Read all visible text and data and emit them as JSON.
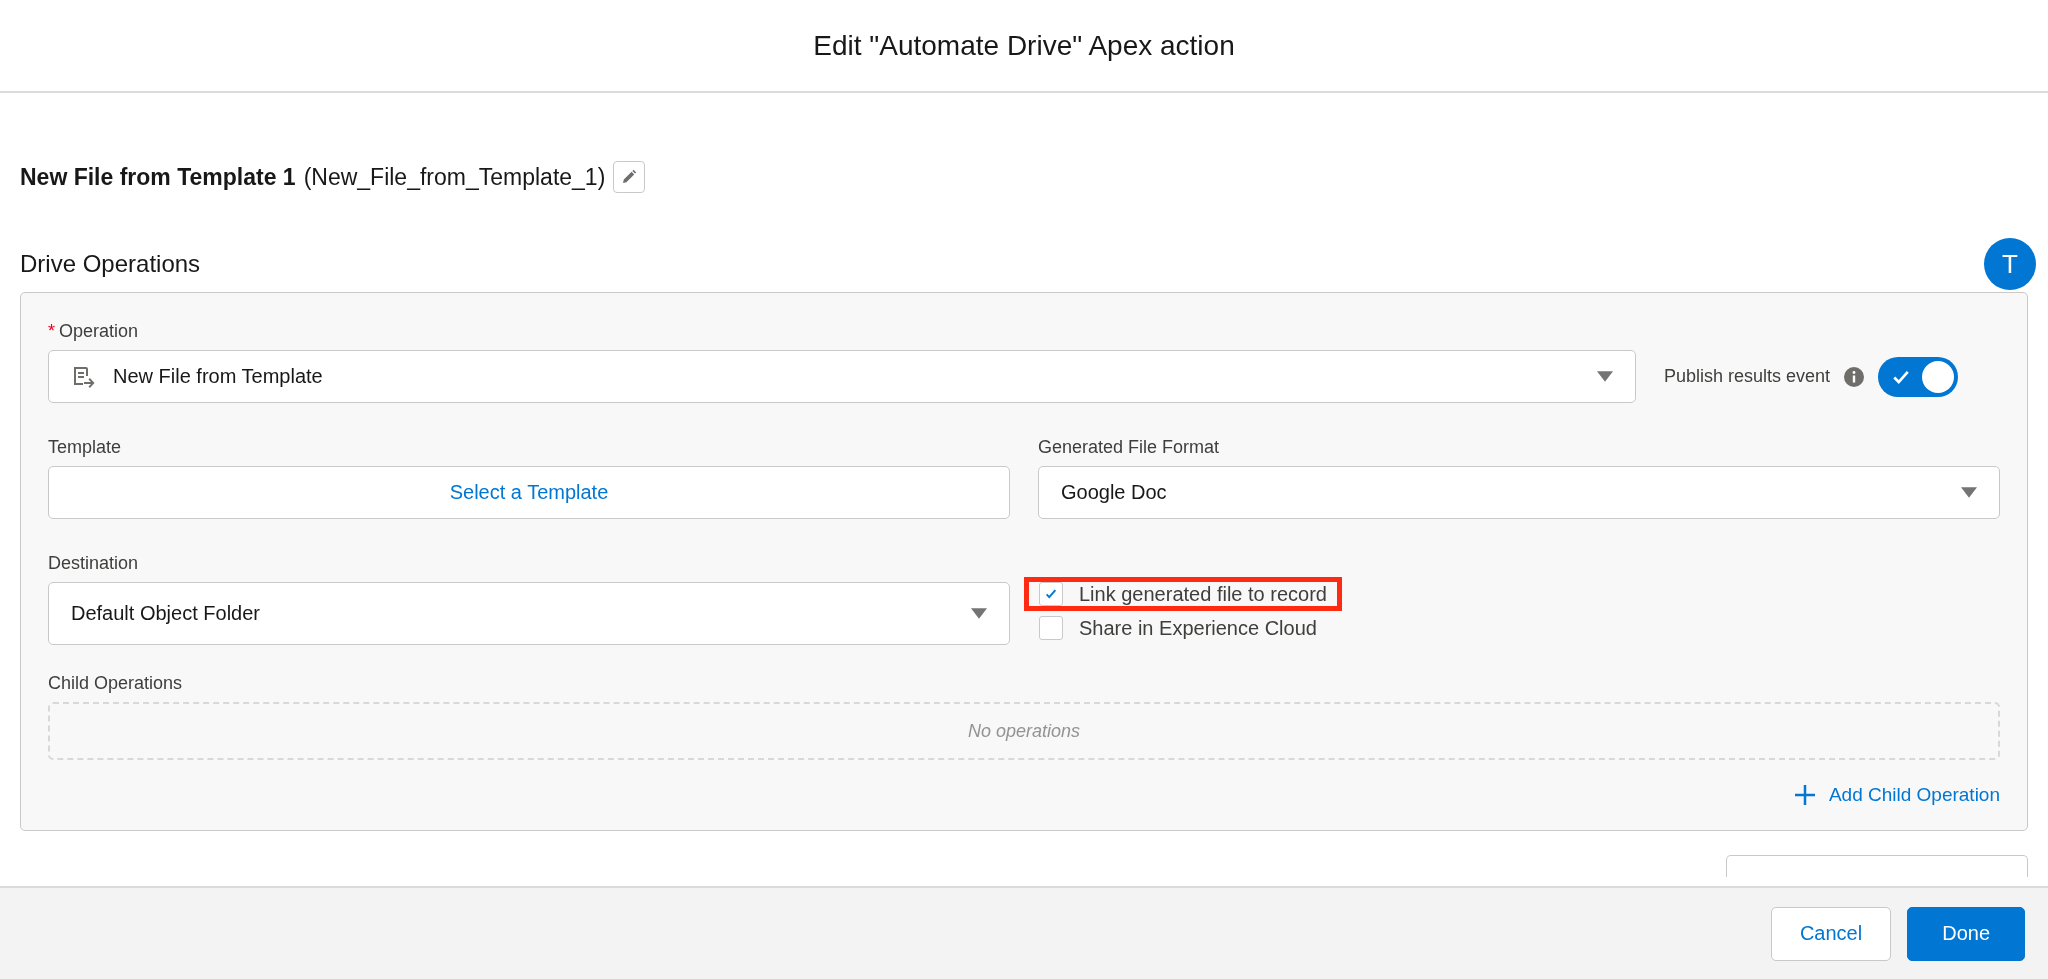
{
  "window": {
    "title": "Edit \"Automate Drive\" Apex action"
  },
  "action": {
    "label": "New File from Template 1",
    "api_name": "(New_File_from_Template_1)"
  },
  "section": {
    "title": "Drive Operations",
    "avatar": "T"
  },
  "operation": {
    "label": "Operation",
    "required_mark": "*",
    "value": "New File from Template"
  },
  "publish": {
    "label": "Publish results event",
    "on": true
  },
  "template": {
    "label": "Template",
    "button": "Select a Template"
  },
  "format": {
    "label": "Generated File Format",
    "value": "Google Doc"
  },
  "destination": {
    "label": "Destination",
    "value": "Default Object Folder"
  },
  "options": [
    {
      "label": "Link generated file to record",
      "checked": true,
      "highlighted": true
    },
    {
      "label": "Share in Experience Cloud",
      "checked": false,
      "highlighted": false
    }
  ],
  "child_operations": {
    "label": "Child Operations",
    "empty_text": "No operations"
  },
  "add_child": "Add Child Operation",
  "footer": {
    "buttons": [
      {
        "label": "Cancel",
        "kind": "neutral"
      },
      {
        "label": "Done",
        "kind": "brand"
      }
    ]
  }
}
